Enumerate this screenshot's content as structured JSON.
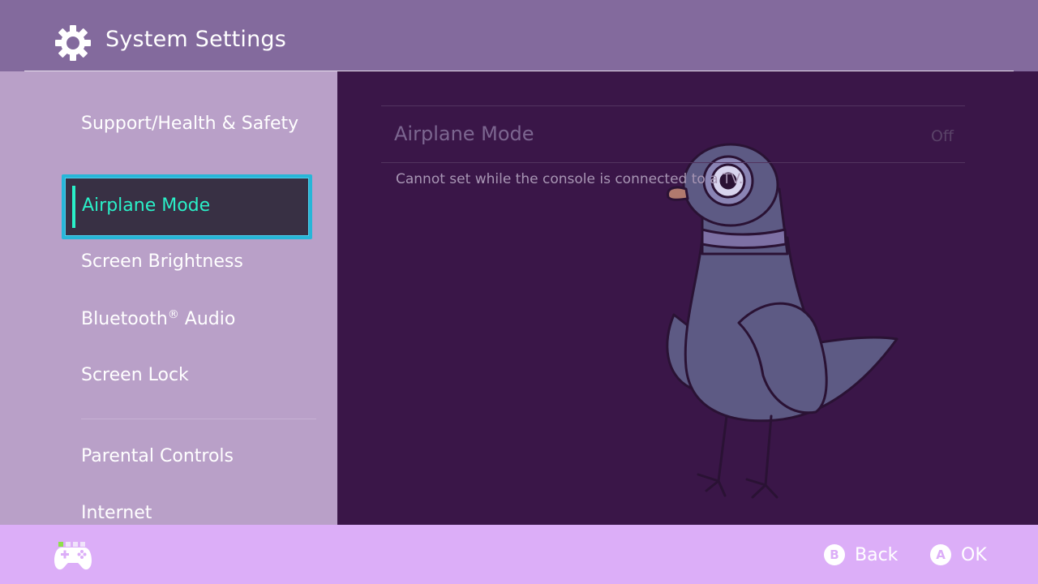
{
  "header": {
    "title": "System Settings",
    "icon": "gear-icon"
  },
  "sidebar": {
    "items": [
      {
        "label": "Support/Health & Safety"
      },
      {
        "label": "Airplane Mode",
        "selected": true
      },
      {
        "label": "Screen Brightness"
      },
      {
        "label": "Bluetooth",
        "registered_mark": "®",
        "label_suffix": " Audio"
      },
      {
        "label": "Screen Lock"
      },
      {
        "label": "Parental Controls"
      },
      {
        "label": "Internet"
      }
    ]
  },
  "content": {
    "setting_label": "Airplane Mode",
    "setting_value": "Off",
    "note": "Cannot set while the console is connected to a TV."
  },
  "footer": {
    "page_dots": 4,
    "active_dot": 1,
    "back": {
      "key": "B",
      "label": "Back"
    },
    "ok": {
      "key": "A",
      "label": "OK"
    }
  },
  "colors": {
    "accent": "#2af0c8",
    "selection_border": "#27b6d8",
    "header_bg": "#836a9d",
    "sidebar_bg": "#b9a0c8",
    "content_bg": "#3a1648",
    "footer_bg": "#dcaef8"
  }
}
